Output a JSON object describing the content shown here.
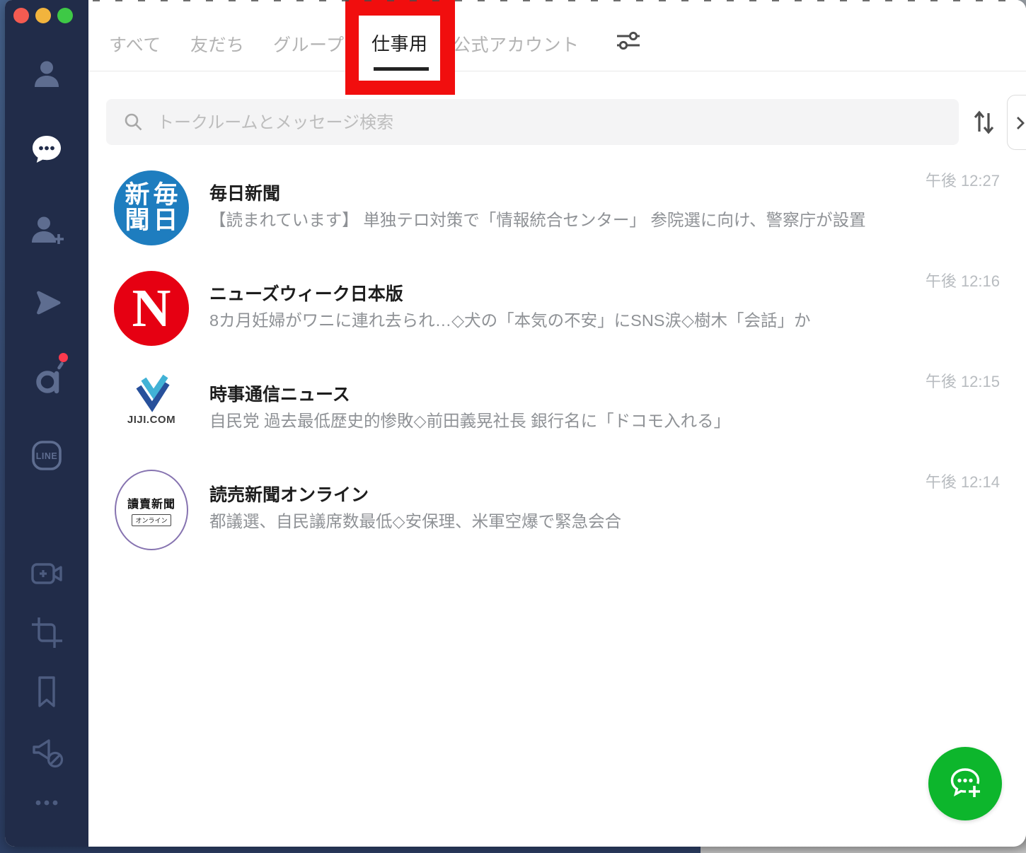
{
  "app": {
    "name": "LINE",
    "window_controls": [
      "close",
      "minimize",
      "zoom"
    ]
  },
  "sidebar": {
    "line_logo_text": "LINE",
    "items": [
      {
        "name": "friends",
        "icon": "person-icon",
        "active": false
      },
      {
        "name": "chats",
        "icon": "chat-bubble-icon",
        "active": true
      },
      {
        "name": "add-friend",
        "icon": "person-add-icon",
        "active": false
      },
      {
        "name": "voom",
        "icon": "voom-play-icon",
        "active": false
      },
      {
        "name": "openchat",
        "icon": "openchat-a-icon",
        "active": false,
        "badge": true
      },
      {
        "name": "line-services",
        "icon": "line-logo-icon",
        "active": false
      },
      {
        "name": "meeting",
        "icon": "video-plus-icon",
        "active": false
      },
      {
        "name": "capture",
        "icon": "crop-icon",
        "active": false
      },
      {
        "name": "keep",
        "icon": "bookmark-icon",
        "active": false
      },
      {
        "name": "notifications-off",
        "icon": "megaphone-off-icon",
        "active": false
      },
      {
        "name": "more",
        "icon": "ellipsis-icon",
        "active": false
      }
    ]
  },
  "tabs": {
    "items": [
      {
        "label": "すべて",
        "active": false
      },
      {
        "label": "友だち",
        "active": false
      },
      {
        "label": "グループ",
        "active": false
      },
      {
        "label": "仕事用",
        "active": true
      },
      {
        "label": "公式アカウント",
        "active": false
      }
    ],
    "filter_icon": "filter-sliders-icon"
  },
  "annotation": {
    "type": "highlight-box",
    "target_tab": "仕事用",
    "color": "#f10e0e"
  },
  "search": {
    "placeholder": "トークルームとメッセージ検索",
    "left_icon": "search-icon",
    "sort_icon": "sort-arrows-icon"
  },
  "panel_toggle": {
    "icon": "chevron-right-icon"
  },
  "chats": [
    {
      "name": "毎日新聞",
      "message": "【読まれています】 単独テロ対策で「情報統合センター」  参院選に向け、警察庁が設置",
      "time": "午後 12:27",
      "avatar": {
        "style": "mainichi",
        "bg": "#1e7dbf",
        "lines": [
          "新毎",
          "聞日"
        ]
      }
    },
    {
      "name": "ニューズウィーク日本版",
      "message": "8カ月妊婦がワニに連れ去られ…◇犬の「本気の不安」にSNS涙◇樹木「会話」か",
      "time": "午後 12:16",
      "avatar": {
        "style": "newsweek",
        "bg": "#e60012",
        "letter": "N"
      }
    },
    {
      "name": "時事通信ニュース",
      "message": "自民党 過去最低歴史的惨敗◇前田義晃社長 銀行名に「ドコモ入れる」",
      "time": "午後 12:15",
      "avatar": {
        "style": "jiji",
        "caption": "JIJI.COM"
      }
    },
    {
      "name": "読売新聞オンライン",
      "message": "都議選、自民議席数最低◇安保理、米軍空爆で緊急会合",
      "time": "午後 12:14",
      "avatar": {
        "style": "yomiuri",
        "border": "#8673b0",
        "text": "讀賣新聞",
        "sub": "オンライン"
      }
    }
  ],
  "fab": {
    "icon": "new-chat-icon",
    "color": "#0db62c"
  },
  "colors": {
    "sidebar_bg": "#212c49",
    "sidebar_icon": "#5e6d90",
    "sidebar_icon_dim": "#4d5c80",
    "active_icon": "#ffffff",
    "tab_inactive": "#b3b3b3",
    "tab_active": "#1d1d1d",
    "annotation_red": "#f10e0e",
    "search_bg": "#f4f4f5",
    "fab_green": "#0db62c",
    "badge_red": "#fc3a4d",
    "timestamp": "#b8bcc0"
  }
}
